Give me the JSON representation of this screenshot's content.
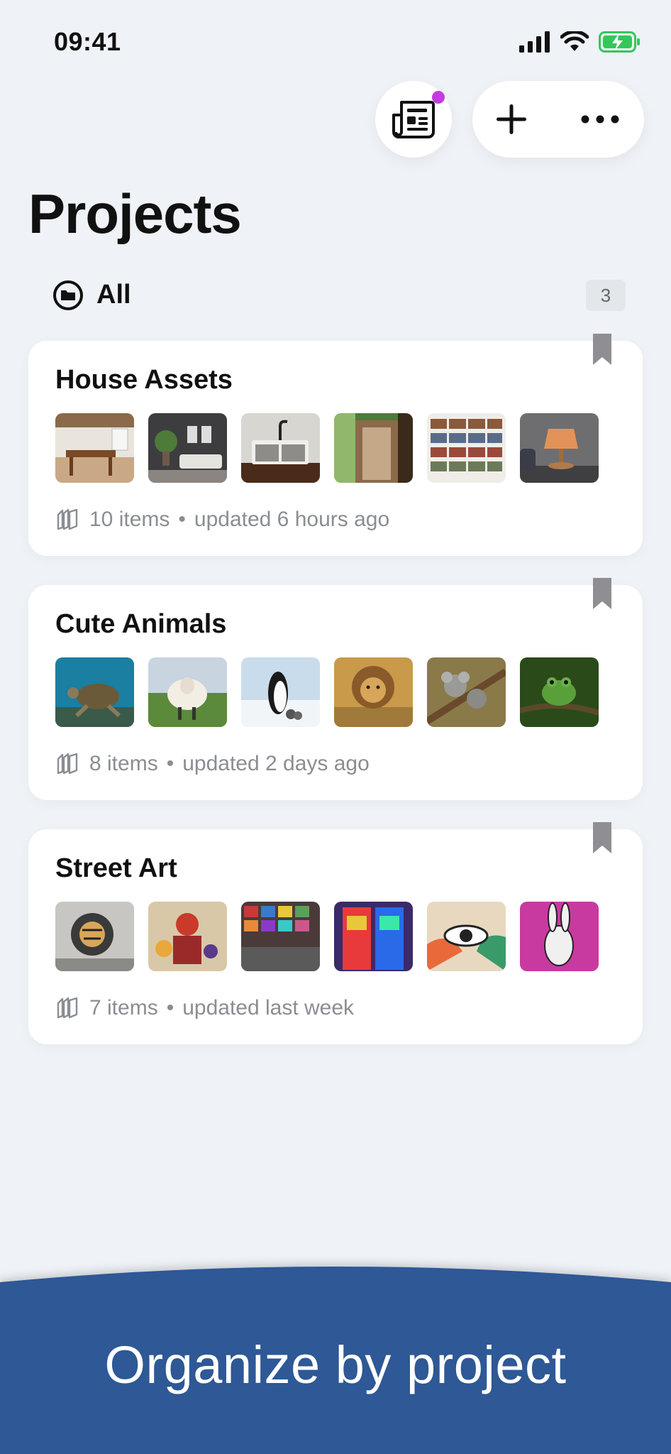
{
  "status": {
    "time": "09:41"
  },
  "page": {
    "title": "Projects"
  },
  "filter": {
    "label": "All",
    "count": "3"
  },
  "projects": [
    {
      "title": "House Assets",
      "items": "10 items",
      "updated": "updated 6 hours ago",
      "thumbs": [
        "dining-room",
        "living-room",
        "kitchen-sink",
        "forest-door",
        "bookshelf",
        "table-lamp"
      ]
    },
    {
      "title": "Cute Animals",
      "items": "8 items",
      "updated": "updated 2 days ago",
      "thumbs": [
        "sea-turtle",
        "sheep",
        "penguins",
        "lion",
        "koalas",
        "frog"
      ]
    },
    {
      "title": "Street Art",
      "items": "7 items",
      "updated": "updated last week",
      "thumbs": [
        "tiger-mural",
        "figure-mural",
        "wall-collage",
        "colorful-door",
        "eye-mural",
        "rabbit-mural"
      ]
    }
  ],
  "banner": {
    "text": "Organize by project"
  },
  "colors": {
    "background": "#eff2f6",
    "accent_dot": "#c43ce0",
    "banner": "#2f5996",
    "battery": "#34c759"
  }
}
